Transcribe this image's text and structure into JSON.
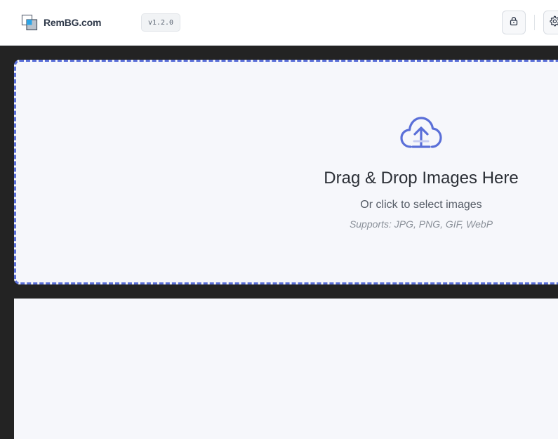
{
  "header": {
    "brand": "RemBG.com",
    "version": "v1.2.0",
    "icons": {
      "logo": "layered-squares-logo",
      "lock": "lock-icon",
      "settings": "gear-icon"
    }
  },
  "dropzone": {
    "icon": "cloud-upload-icon",
    "title": "Drag & Drop Images Here",
    "subtitle": "Or click to select images",
    "formats": "Supports: JPG, PNG, GIF, WebP"
  },
  "colors": {
    "accent": "#5a6fd8",
    "background": "#232323",
    "panel": "#f6f7fb"
  }
}
